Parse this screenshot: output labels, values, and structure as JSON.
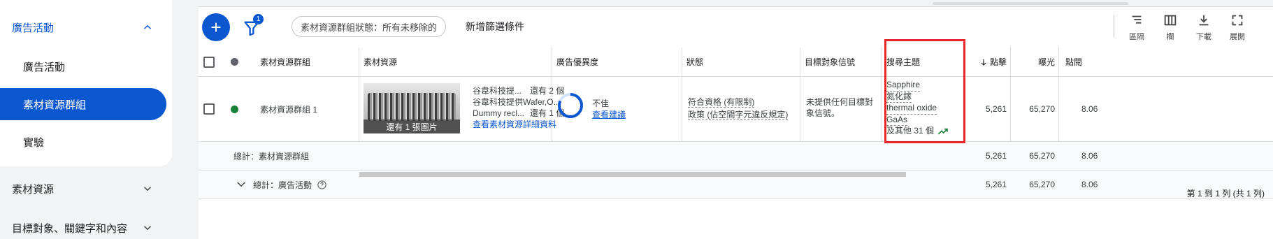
{
  "sidebar": {
    "section_title": "廣告活動",
    "items": [
      {
        "label": "廣告活動",
        "active": false
      },
      {
        "label": "素材資源群組",
        "active": true
      },
      {
        "label": "實驗",
        "active": false
      }
    ],
    "sections": [
      {
        "label": "素材資源"
      },
      {
        "label": "目標對象、關鍵字和內容"
      }
    ]
  },
  "toolbar": {
    "filter_badge": "1",
    "filter_chip": "素材資源群組狀態：所有未移除的",
    "add_filter": "新增篩選條件",
    "tools": [
      {
        "label": "區隔",
        "icon": "segment-icon"
      },
      {
        "label": "欄",
        "icon": "columns-icon"
      },
      {
        "label": "下載",
        "icon": "download-icon"
      },
      {
        "label": "展開",
        "icon": "expand-icon"
      }
    ]
  },
  "table": {
    "headers": {
      "asset_group": "素材資源群組",
      "assets": "素材資源",
      "ad_strength": "廣告優異度",
      "status": "狀態",
      "audience_signal": "目標對象信號",
      "search_themes": "搜尋主題",
      "clicks": "點擊",
      "impressions": "曝光",
      "ctr": "點閱"
    },
    "row": {
      "name": "素材資源群組 1",
      "thumb_caption": "還有 1 張圖片",
      "asset_line1": "谷韋科技提...",
      "asset_line1_more": "還有 2 個",
      "asset_line2": "谷韋科技提供Wafer,O...",
      "asset_line3": "Dummy recl...",
      "asset_line3_more": "還有 1 個",
      "asset_link": "查看素材資源詳細資料",
      "ad_strength": "不佳",
      "ad_strength_link": "查看建議",
      "status_line1": "符合資格 (有限制)",
      "status_line2": "政策 (佔空間字元違反規定)",
      "audience": "未提供任何目標對象信號。",
      "themes": [
        "Sapphire",
        "氮化鎵",
        "thermal oxide",
        "GaAs"
      ],
      "themes_more": "及其他 31 個",
      "clicks": "5,261",
      "impressions": "65,270",
      "ctr": "8.06"
    },
    "total_asset_groups": {
      "label": "總計：素材資源群組",
      "clicks": "5,261",
      "impressions": "65,270",
      "ctr": "8.06"
    },
    "total_campaigns": {
      "label": "總計：廣告活動",
      "clicks": "5,261",
      "impressions": "65,270",
      "ctr": "8.06"
    }
  },
  "pagination": "第 1 到 1 列 (共 1 列)",
  "colors": {
    "accent": "#0b57d0",
    "status_enabled": "#188038",
    "highlight_box": "#e8262b"
  }
}
